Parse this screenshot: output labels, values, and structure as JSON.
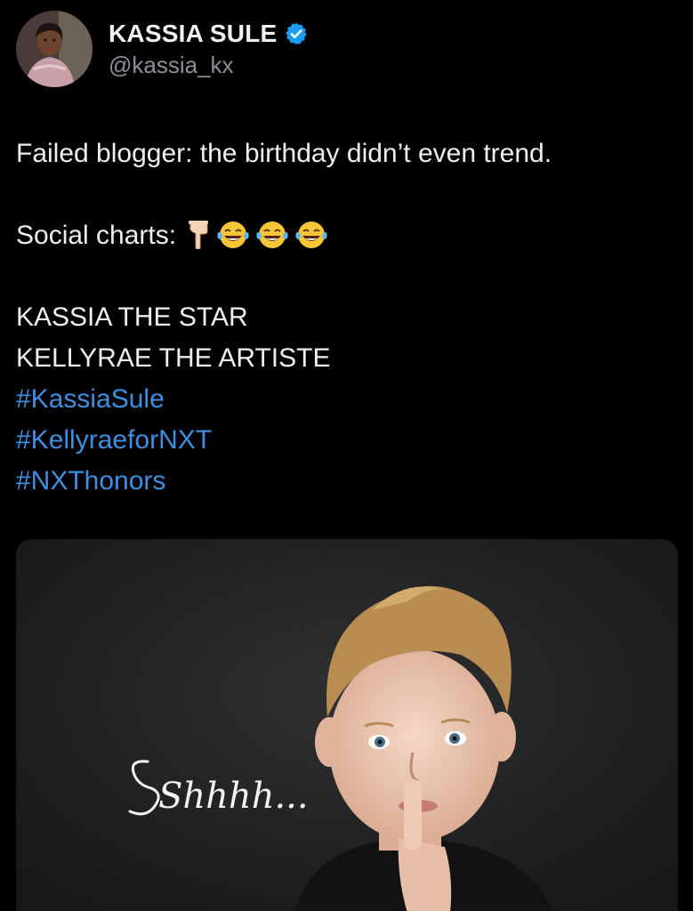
{
  "user": {
    "display_name": "KASSIA SULE",
    "handle": "@kassia_kx",
    "verified": true,
    "avatar_icon": "profile-photo-avatar"
  },
  "tweet": {
    "line1": "Failed blogger: the birthday didn’t even trend.",
    "line2_text": "Social charts:",
    "line2_emojis": [
      "pointing-down-hand-emoji",
      "tears-of-joy-emoji",
      "tears-of-joy-emoji",
      "tears-of-joy-emoji"
    ],
    "line3": "KASSIA THE STAR",
    "line4": "KELLYRAE THE ARTISTE",
    "hashtags": [
      "#KassiaSule",
      "#KellyraeforNXT",
      "#NXThonors"
    ]
  },
  "media": {
    "caption_text": "Shhhh...",
    "description_icon": "child-shushing-photo"
  },
  "colors": {
    "background": "#000000",
    "text": "#eceef0",
    "handle": "#8b9096",
    "hashtag": "#3f8fe0",
    "verified": "#1d9bf0"
  }
}
